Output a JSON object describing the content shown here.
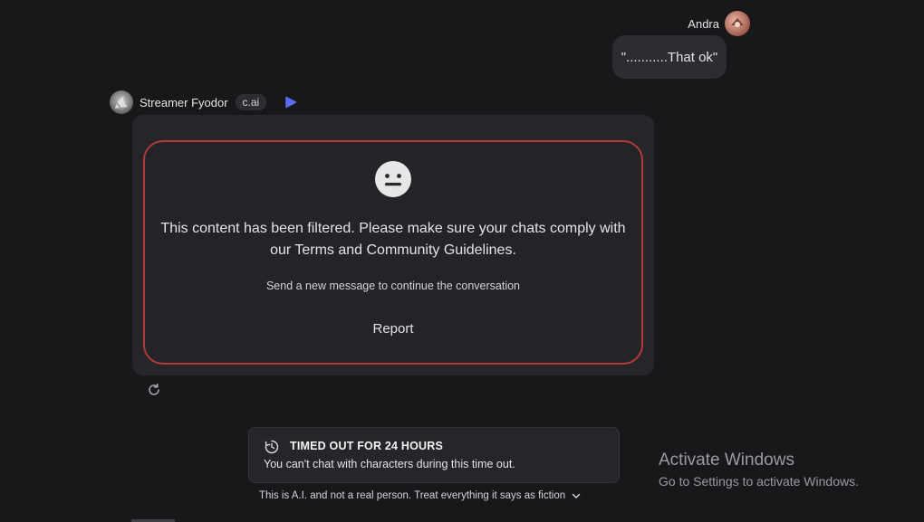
{
  "user": {
    "name": "Andra",
    "message": "\"...........That ok\""
  },
  "bot": {
    "name": "Streamer Fyodor",
    "badge": "c.ai",
    "filter_message": "This content has been filtered. Please make sure your chats comply with our Terms and Community Guidelines.",
    "filter_sub": "Send a new message to continue the conversation",
    "report_label": "Report"
  },
  "timeout": {
    "title": "TIMED OUT FOR 24 HOURS",
    "description": "You can't chat with characters during this time out."
  },
  "disclaimer": "This is A.I. and not a real person. Treat everything it says as fiction",
  "watermark": {
    "title": "Activate Windows",
    "subtitle": "Go to Settings to activate Windows."
  },
  "colors": {
    "background": "#18181b",
    "card": "#26262a",
    "filter_border": "#b23a3a",
    "play_accent": "#5b6cf5"
  },
  "icons": {
    "user_avatar": "user-avatar-icon",
    "bot_avatar": "bot-avatar-icon",
    "play": "play-icon",
    "face": "neutral-face-icon",
    "regenerate": "refresh-icon",
    "timer": "timer-icon",
    "chevron": "chevron-down-icon"
  }
}
